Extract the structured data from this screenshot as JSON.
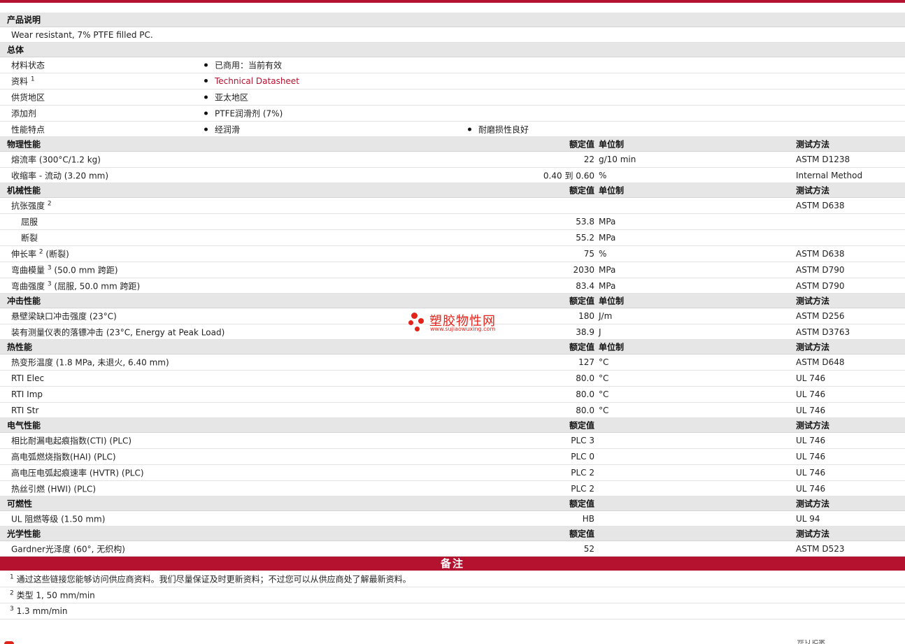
{
  "colors": {
    "brand_red": "#b5122f",
    "section_bg": "#e6e6e6",
    "watermark_red": "#e2231a"
  },
  "headers": {
    "value": "额定值",
    "unit": "单位制",
    "test": "测试方法"
  },
  "product_description": {
    "title": "产品说明",
    "text": "Wear resistant, 7% PTFE filled PC."
  },
  "general": {
    "title": "总体",
    "material_status": {
      "label": "材料状态",
      "value": "已商用：当前有效"
    },
    "documentation": {
      "label": "资料",
      "sup": "1",
      "link": "Technical Datasheet"
    },
    "availability": {
      "label": "供货地区",
      "value": "亚太地区"
    },
    "additive": {
      "label": "添加剂",
      "value": "PTFE润滑剂 (7%)"
    },
    "features": {
      "label": "性能特点",
      "value1": "经润滑",
      "value2": "耐磨损性良好"
    }
  },
  "physical": {
    "title": "物理性能",
    "rows": [
      {
        "name": "熔流率 (300°C/1.2 kg)",
        "value": "22",
        "unit": "g/10 min",
        "test": "ASTM D1238"
      },
      {
        "name": "收缩率 - 流动 (3.20 mm)",
        "value": "0.40 到 0.60",
        "unit": "%",
        "test": "Internal Method"
      }
    ]
  },
  "mechanical": {
    "title": "机械性能",
    "tensile": {
      "name": "抗张强度",
      "sup": "2",
      "test": "ASTM D638"
    },
    "yield": {
      "name": "屈服",
      "value": "53.8",
      "unit": "MPa"
    },
    "break": {
      "name": "断裂",
      "value": "55.2",
      "unit": "MPa"
    },
    "elongation": {
      "name": "伸长率",
      "sup": "2",
      "suffix": "(断裂)",
      "value": "75",
      "unit": "%",
      "test": "ASTM D638"
    },
    "flex_modulus": {
      "name": "弯曲模量",
      "sup": "3",
      "suffix": "(50.0 mm 跨距)",
      "value": "2030",
      "unit": "MPa",
      "test": "ASTM D790"
    },
    "flex_strength": {
      "name": "弯曲强度",
      "sup": "3",
      "suffix": "(屈服, 50.0 mm 跨距)",
      "value": "83.4",
      "unit": "MPa",
      "test": "ASTM D790"
    }
  },
  "impact": {
    "title": "冲击性能",
    "rows": [
      {
        "name": "悬壁梁缺口冲击强度 (23°C)",
        "value": "180",
        "unit": "J/m",
        "test": "ASTM D256"
      },
      {
        "name": "装有测量仪表的落镖冲击 (23°C, Energy at Peak Load)",
        "value": "38.9",
        "unit": "J",
        "test": "ASTM D3763"
      }
    ]
  },
  "thermal": {
    "title": "热性能",
    "rows": [
      {
        "name": "热变形温度 (1.8 MPa, 未退火, 6.40 mm)",
        "value": "127",
        "unit": "°C",
        "test": "ASTM D648"
      },
      {
        "name": "RTI Elec",
        "value": "80.0",
        "unit": "°C",
        "test": "UL 746"
      },
      {
        "name": "RTI Imp",
        "value": "80.0",
        "unit": "°C",
        "test": "UL 746"
      },
      {
        "name": "RTI Str",
        "value": "80.0",
        "unit": "°C",
        "test": "UL 746"
      }
    ]
  },
  "electrical": {
    "title": "电气性能",
    "rows": [
      {
        "name": "相比耐漏电起痕指数(CTI) (PLC)",
        "value": "PLC 3",
        "test": "UL 746"
      },
      {
        "name": "高电弧燃烧指数(HAI) (PLC)",
        "value": "PLC 0",
        "test": "UL 746"
      },
      {
        "name": "高电压电弧起痕速率 (HVTR) (PLC)",
        "value": "PLC 2",
        "test": "UL 746"
      },
      {
        "name": "热丝引燃 (HWI) (PLC)",
        "value": "PLC 2",
        "test": "UL 746"
      }
    ]
  },
  "flammability": {
    "title": "可燃性",
    "rows": [
      {
        "name": "UL 阻燃等级 (1.50 mm)",
        "value": "HB",
        "test": "UL 94"
      }
    ]
  },
  "optical": {
    "title": "光学性能",
    "rows": [
      {
        "name": "Gardner光泽度 (60°, 无织构)",
        "value": "52",
        "test": "ASTM D523"
      }
    ]
  },
  "notes": {
    "title": "备注",
    "items": [
      {
        "sup": "1",
        "text": "通过这些链接您能够访问供应商资料。我们尽量保证及时更新资料；不过您可以从供应商处了解最新资料。"
      },
      {
        "sup": "2",
        "text": "类型 1, 50 mm/min"
      },
      {
        "sup": "3",
        "text": "1.3 mm/min"
      }
    ]
  },
  "watermark": {
    "cn": "塑胶物性网",
    "en": "www.sujiaowuxing.com"
  },
  "footer_partial": "修订记录"
}
